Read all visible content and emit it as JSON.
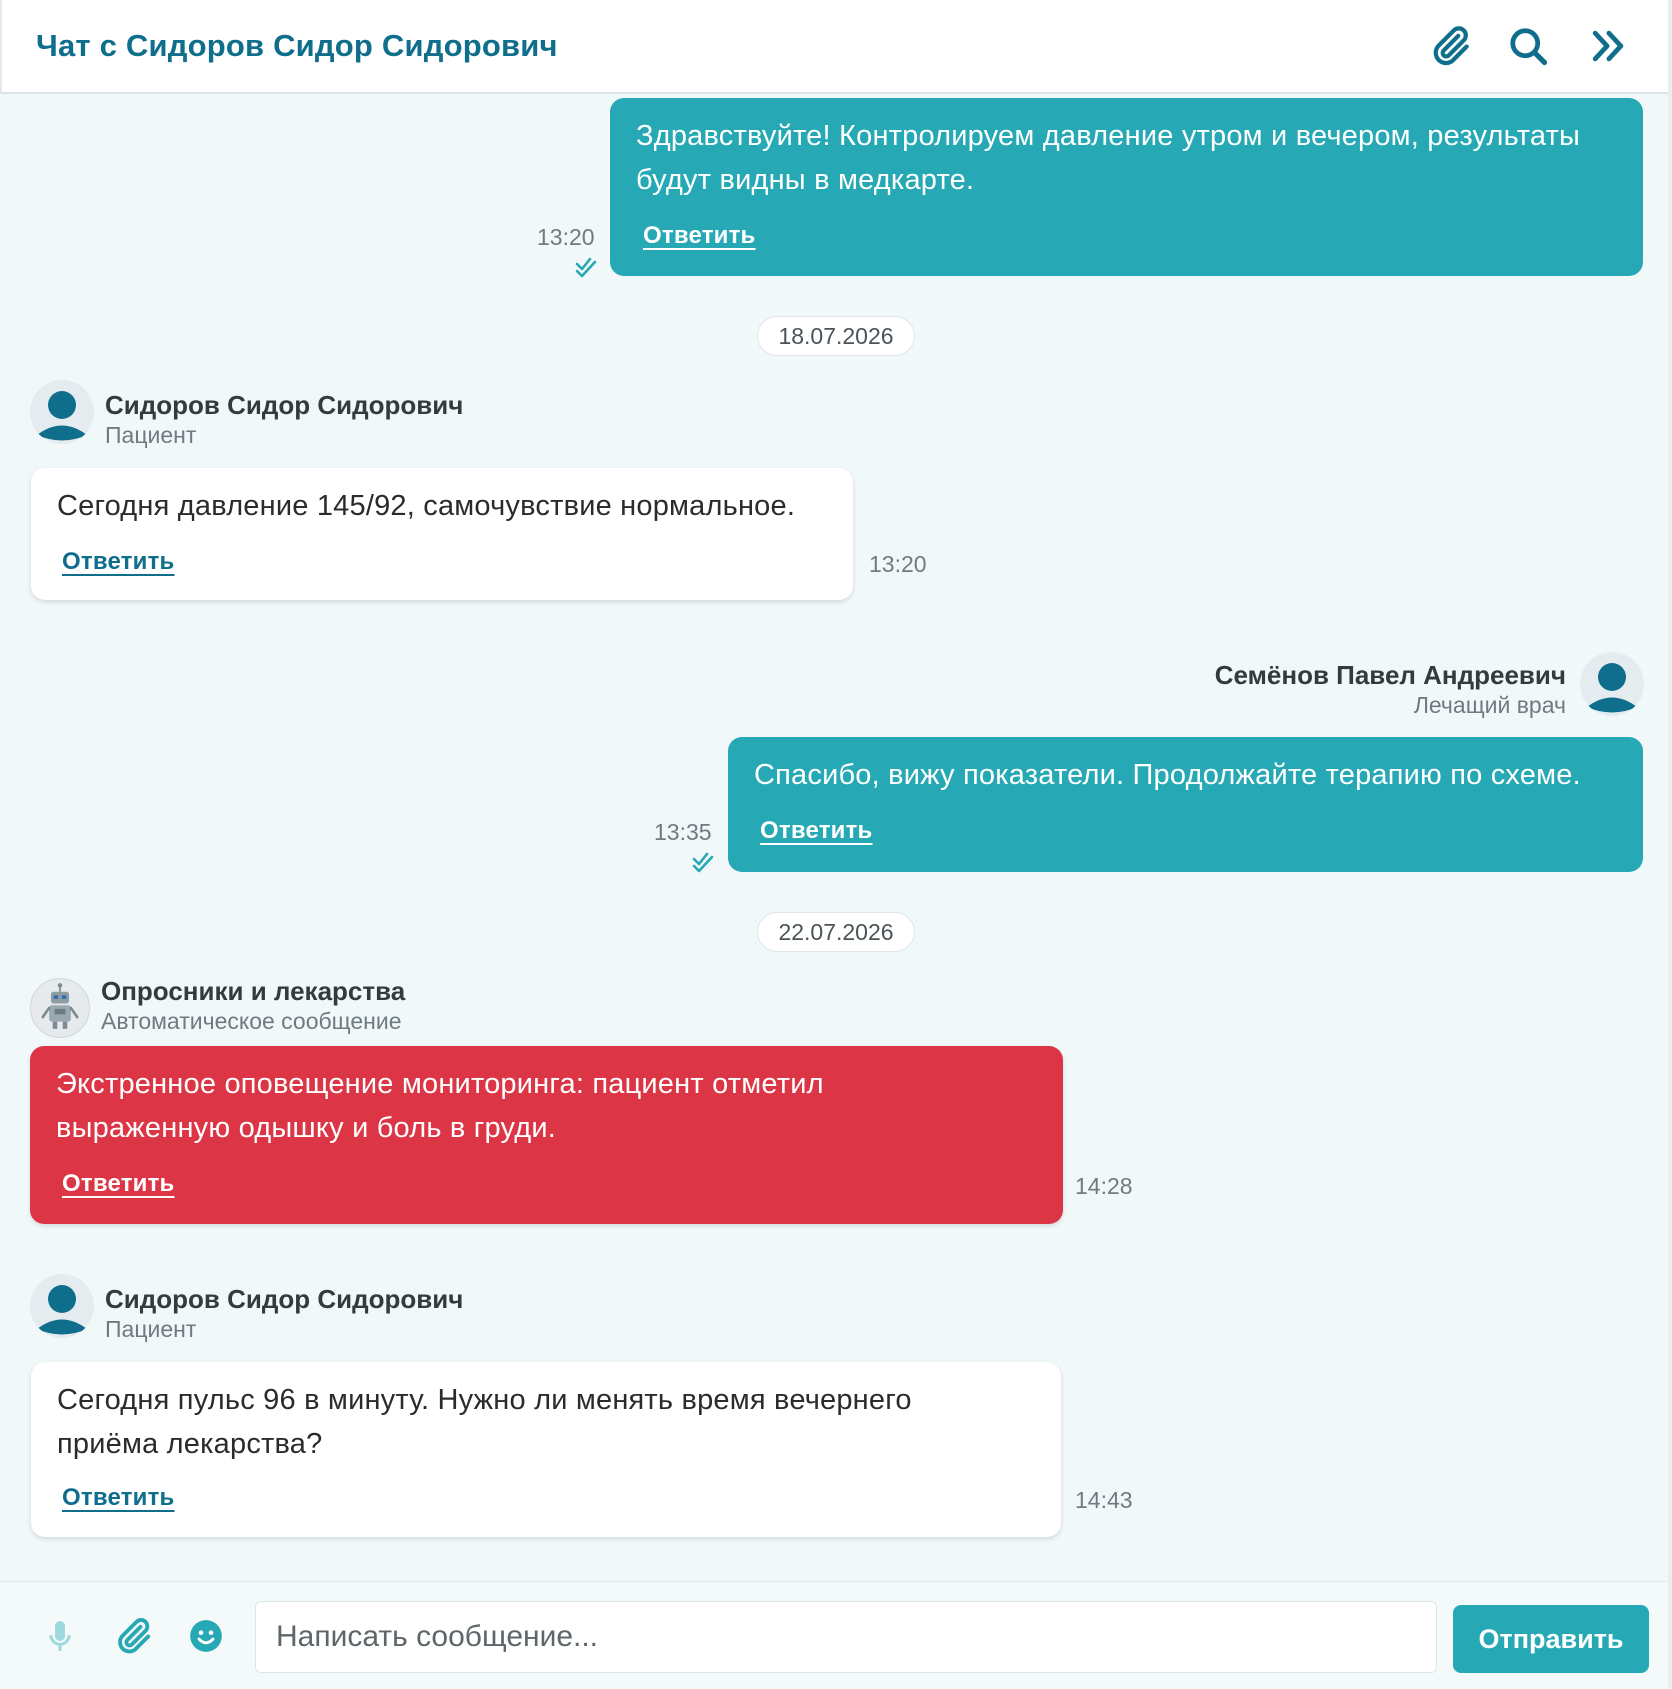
{
  "header": {
    "title": "Чат с Сидоров Сидор Сидорович",
    "icons": [
      "paperclip-icon",
      "search-icon",
      "double-chevron-right-icon"
    ]
  },
  "colors": {
    "accent": "#26a9b4",
    "brand_text": "#0f6e8c",
    "alert": "#dc3545",
    "background": "#f1f8fa"
  },
  "messages": [
    {
      "direction": "outgoing",
      "text": "Здравствуйте! Контролируем давление утром и вечером, результаты будут видны в медкарте.",
      "reply_label": "Ответить",
      "time": "13:20",
      "read": true
    },
    {
      "date_separator": "18.07.2026"
    },
    {
      "direction": "incoming",
      "sender": "Сидоров Сидор Сидорович",
      "role": "Пациент",
      "text": "Сегодня давление 145/92, самочувствие нормальное.",
      "reply_label": "Ответить",
      "time": "13:20"
    },
    {
      "direction": "outgoing",
      "sender": "Семёнов Павел Андреевич",
      "role": "Лечащий врач",
      "text": "Спасибо, вижу показатели. Продолжайте терапию по схеме.",
      "reply_label": "Ответить",
      "time": "13:35",
      "read": true
    },
    {
      "date_separator": "22.07.2026"
    },
    {
      "direction": "incoming",
      "type": "alert",
      "sender": "Опросники и лекарства",
      "role": "Автоматическое сообщение",
      "text": "Экстренное оповещение мониторинга: пациент отметил выраженную одышку и боль в груди.",
      "reply_label": "Ответить",
      "time": "14:28"
    },
    {
      "direction": "incoming",
      "sender": "Сидоров Сидор Сидорович",
      "role": "Пациент",
      "text": "Сегодня пульс 96 в минуту. Нужно ли менять время вечернего приёма лекарства?",
      "reply_label": "Ответить",
      "time": "14:43"
    }
  ],
  "composer": {
    "placeholder": "Написать сообщение...",
    "value": "",
    "send_label": "Отправить",
    "icons": [
      "microphone-icon",
      "paperclip-icon",
      "emoji-icon"
    ]
  }
}
